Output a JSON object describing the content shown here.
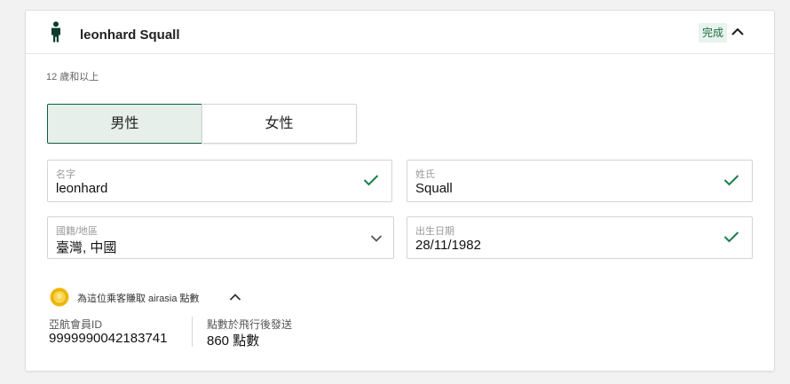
{
  "passenger": {
    "name": "leonhard Squall",
    "status": "完成",
    "age_note": "12 歲和以上"
  },
  "gender": {
    "male": "男性",
    "female": "女性",
    "selected": "male"
  },
  "fields": {
    "first_name": {
      "label": "名字",
      "value": "leonhard"
    },
    "last_name": {
      "label": "姓氏",
      "value": "Squall"
    },
    "nationality": {
      "label": "國籍/地區",
      "value": "臺灣, 中國"
    },
    "birth_date": {
      "label": "出生日期",
      "value": "28/11/1982"
    }
  },
  "points": {
    "title": "為這位乘客賺取 airasia 點數",
    "member_label": "亞航會員ID",
    "member_value": "9999990042183741",
    "earn_label": "點數於飛行後發送",
    "earn_value": "860 點數"
  },
  "colors": {
    "accent_green": "#0d5c42",
    "check_green": "#1a7f4b",
    "badge_bg": "#e7f3ec",
    "coin_gold": "#f0b90b"
  }
}
